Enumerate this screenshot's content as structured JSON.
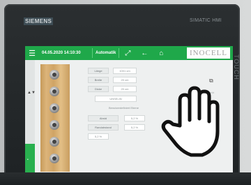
{
  "device": {
    "brand": "SIEMENS",
    "model": "SIMATIC HMI",
    "touch_label": "TOUCH"
  },
  "hmi": {
    "datetime": "04.05.2020 14:10:30",
    "mode": "Automatik",
    "logo": "INOCELL",
    "rail_label": "▲▼",
    "rail_indicator": "•",
    "icons": [
      "expand-icon",
      "back-arrow-icon",
      "home-icon"
    ]
  },
  "form": {
    "rows": [
      {
        "label": "Länge",
        "value": "1001 cm"
      },
      {
        "label": "Breite",
        "value": "20 cm"
      },
      {
        "label": "Dicke",
        "value": "20 cm"
      }
    ],
    "dropdown": "UNSELIN",
    "section_title": "Benutzerdefiniert Ebene",
    "row2": [
      {
        "label": "Abstd",
        "value": "5,2 %"
      },
      {
        "label": "Randabstand",
        "value": "5,2 %"
      }
    ],
    "extra": "5,2 %"
  },
  "right": {
    "icon": "copy-icon",
    "sub": "Ansicht"
  },
  "overlay": {
    "icon": "pointing-hand-icon"
  },
  "colors": {
    "accent": "#1fa84a",
    "bezel": "#23282a",
    "screen_bg": "#eef0f0"
  }
}
